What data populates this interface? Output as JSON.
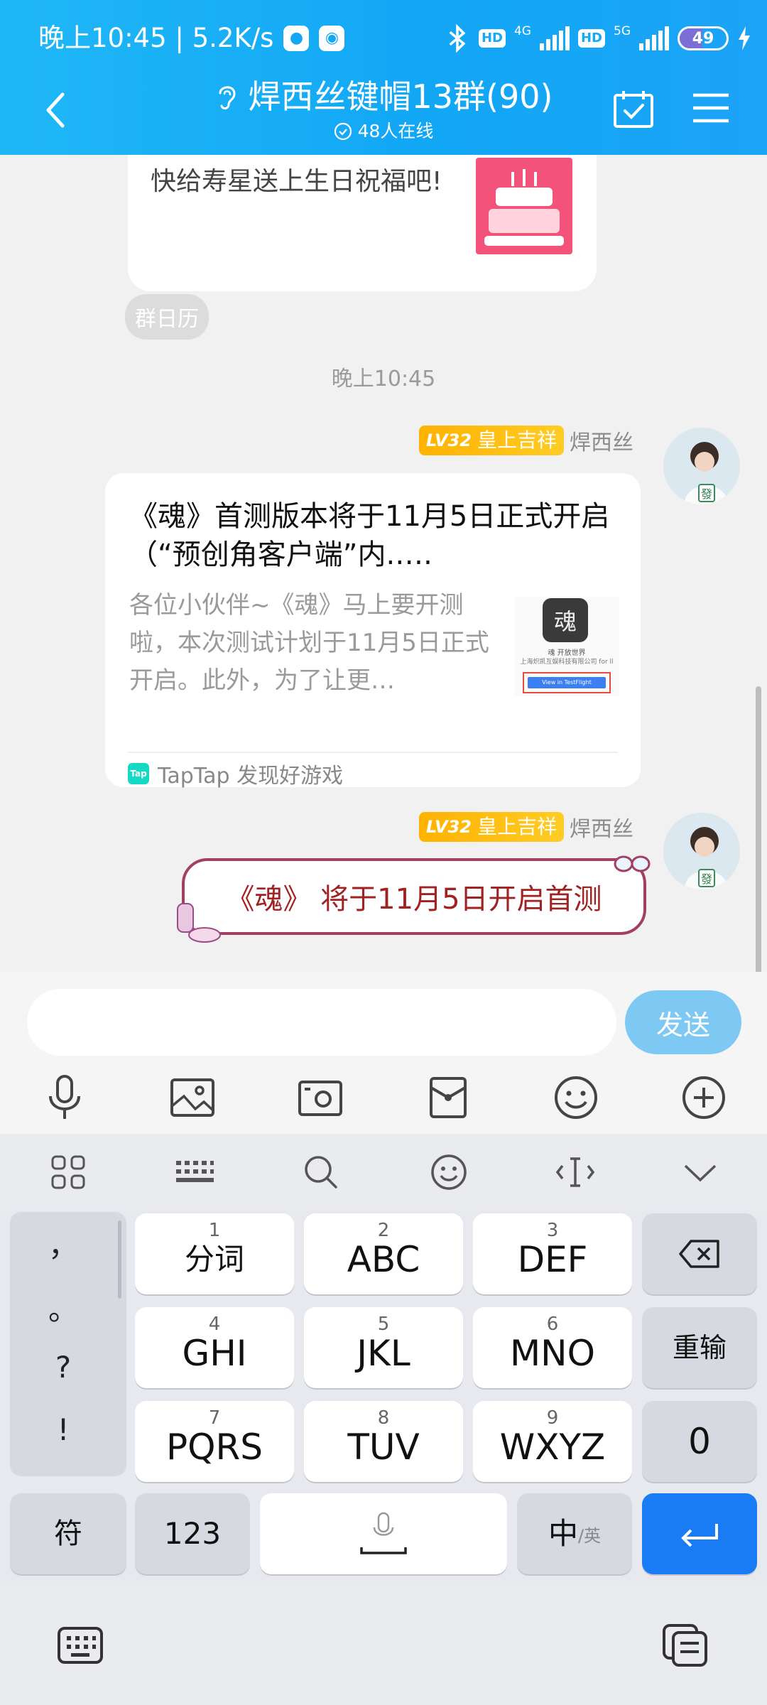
{
  "status": {
    "time_speed": "晚上10:45 | 5.2K/s",
    "hd1": "HD",
    "net1": "4G",
    "hd2": "HD",
    "net2": "5G",
    "battery": "49",
    "battery_level": 0.49
  },
  "header": {
    "title": "焊西丝键帽13群(90)",
    "online": "48人在线"
  },
  "chat": {
    "birthday_text": "快给寿星送上生日祝福吧!",
    "calendar_tag": "群日历",
    "time": "晚上10:45",
    "msg1": {
      "level": "LV32",
      "title_badge": "皇上吉祥",
      "sender": "焊西丝",
      "card_title": "《魂》首测版本将于11月5日正式开启（“预创角客户端”内.….",
      "card_desc": "各位小伙伴~《魂》马上要开测啦，本次测试计划于11月5日正式开启。此外，为了让更…",
      "thumb_caption": "魂 开放世界",
      "thumb_sub": "上海炽凯互娱科技有限公司 for ll",
      "thumb_btn": "View in TestFlight",
      "source_logo": "Tap",
      "source": "TapTap 发现好游戏"
    },
    "msg2": {
      "level": "LV32",
      "title_badge": "皇上吉祥",
      "sender": "焊西丝",
      "text": "《魂》 将于11月5日开启首测"
    }
  },
  "input": {
    "placeholder": "",
    "send": "发送"
  },
  "keyboard": {
    "punct": [
      "，",
      "。",
      "?",
      "!"
    ],
    "keys": [
      {
        "num": "1",
        "label": "分词"
      },
      {
        "num": "2",
        "label": "ABC"
      },
      {
        "num": "3",
        "label": "DEF"
      },
      {
        "num": "4",
        "label": "GHI"
      },
      {
        "num": "5",
        "label": "JKL"
      },
      {
        "num": "6",
        "label": "MNO"
      },
      {
        "num": "7",
        "label": "PQRS"
      },
      {
        "num": "8",
        "label": "TUV"
      },
      {
        "num": "9",
        "label": "WXYZ"
      }
    ],
    "reinput": "重输",
    "zero": "0",
    "symbols": "符",
    "numbers": "123",
    "lang_main": "中",
    "lang_sub": "/英"
  }
}
